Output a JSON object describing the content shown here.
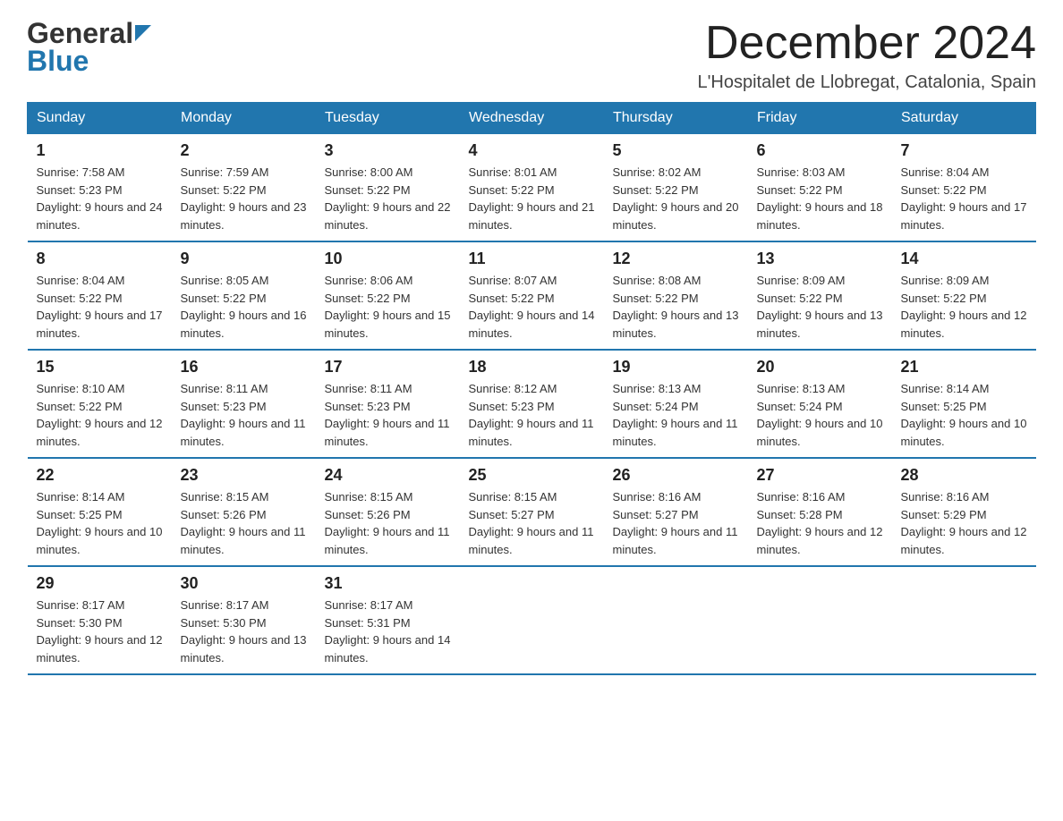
{
  "header": {
    "logo_general": "General",
    "logo_blue": "Blue",
    "month_title": "December 2024",
    "location": "L'Hospitalet de Llobregat, Catalonia, Spain"
  },
  "days_of_week": [
    "Sunday",
    "Monday",
    "Tuesday",
    "Wednesday",
    "Thursday",
    "Friday",
    "Saturday"
  ],
  "weeks": [
    [
      {
        "day": "1",
        "sunrise": "Sunrise: 7:58 AM",
        "sunset": "Sunset: 5:23 PM",
        "daylight": "Daylight: 9 hours and 24 minutes."
      },
      {
        "day": "2",
        "sunrise": "Sunrise: 7:59 AM",
        "sunset": "Sunset: 5:22 PM",
        "daylight": "Daylight: 9 hours and 23 minutes."
      },
      {
        "day": "3",
        "sunrise": "Sunrise: 8:00 AM",
        "sunset": "Sunset: 5:22 PM",
        "daylight": "Daylight: 9 hours and 22 minutes."
      },
      {
        "day": "4",
        "sunrise": "Sunrise: 8:01 AM",
        "sunset": "Sunset: 5:22 PM",
        "daylight": "Daylight: 9 hours and 21 minutes."
      },
      {
        "day": "5",
        "sunrise": "Sunrise: 8:02 AM",
        "sunset": "Sunset: 5:22 PM",
        "daylight": "Daylight: 9 hours and 20 minutes."
      },
      {
        "day": "6",
        "sunrise": "Sunrise: 8:03 AM",
        "sunset": "Sunset: 5:22 PM",
        "daylight": "Daylight: 9 hours and 18 minutes."
      },
      {
        "day": "7",
        "sunrise": "Sunrise: 8:04 AM",
        "sunset": "Sunset: 5:22 PM",
        "daylight": "Daylight: 9 hours and 17 minutes."
      }
    ],
    [
      {
        "day": "8",
        "sunrise": "Sunrise: 8:04 AM",
        "sunset": "Sunset: 5:22 PM",
        "daylight": "Daylight: 9 hours and 17 minutes."
      },
      {
        "day": "9",
        "sunrise": "Sunrise: 8:05 AM",
        "sunset": "Sunset: 5:22 PM",
        "daylight": "Daylight: 9 hours and 16 minutes."
      },
      {
        "day": "10",
        "sunrise": "Sunrise: 8:06 AM",
        "sunset": "Sunset: 5:22 PM",
        "daylight": "Daylight: 9 hours and 15 minutes."
      },
      {
        "day": "11",
        "sunrise": "Sunrise: 8:07 AM",
        "sunset": "Sunset: 5:22 PM",
        "daylight": "Daylight: 9 hours and 14 minutes."
      },
      {
        "day": "12",
        "sunrise": "Sunrise: 8:08 AM",
        "sunset": "Sunset: 5:22 PM",
        "daylight": "Daylight: 9 hours and 13 minutes."
      },
      {
        "day": "13",
        "sunrise": "Sunrise: 8:09 AM",
        "sunset": "Sunset: 5:22 PM",
        "daylight": "Daylight: 9 hours and 13 minutes."
      },
      {
        "day": "14",
        "sunrise": "Sunrise: 8:09 AM",
        "sunset": "Sunset: 5:22 PM",
        "daylight": "Daylight: 9 hours and 12 minutes."
      }
    ],
    [
      {
        "day": "15",
        "sunrise": "Sunrise: 8:10 AM",
        "sunset": "Sunset: 5:22 PM",
        "daylight": "Daylight: 9 hours and 12 minutes."
      },
      {
        "day": "16",
        "sunrise": "Sunrise: 8:11 AM",
        "sunset": "Sunset: 5:23 PM",
        "daylight": "Daylight: 9 hours and 11 minutes."
      },
      {
        "day": "17",
        "sunrise": "Sunrise: 8:11 AM",
        "sunset": "Sunset: 5:23 PM",
        "daylight": "Daylight: 9 hours and 11 minutes."
      },
      {
        "day": "18",
        "sunrise": "Sunrise: 8:12 AM",
        "sunset": "Sunset: 5:23 PM",
        "daylight": "Daylight: 9 hours and 11 minutes."
      },
      {
        "day": "19",
        "sunrise": "Sunrise: 8:13 AM",
        "sunset": "Sunset: 5:24 PM",
        "daylight": "Daylight: 9 hours and 11 minutes."
      },
      {
        "day": "20",
        "sunrise": "Sunrise: 8:13 AM",
        "sunset": "Sunset: 5:24 PM",
        "daylight": "Daylight: 9 hours and 10 minutes."
      },
      {
        "day": "21",
        "sunrise": "Sunrise: 8:14 AM",
        "sunset": "Sunset: 5:25 PM",
        "daylight": "Daylight: 9 hours and 10 minutes."
      }
    ],
    [
      {
        "day": "22",
        "sunrise": "Sunrise: 8:14 AM",
        "sunset": "Sunset: 5:25 PM",
        "daylight": "Daylight: 9 hours and 10 minutes."
      },
      {
        "day": "23",
        "sunrise": "Sunrise: 8:15 AM",
        "sunset": "Sunset: 5:26 PM",
        "daylight": "Daylight: 9 hours and 11 minutes."
      },
      {
        "day": "24",
        "sunrise": "Sunrise: 8:15 AM",
        "sunset": "Sunset: 5:26 PM",
        "daylight": "Daylight: 9 hours and 11 minutes."
      },
      {
        "day": "25",
        "sunrise": "Sunrise: 8:15 AM",
        "sunset": "Sunset: 5:27 PM",
        "daylight": "Daylight: 9 hours and 11 minutes."
      },
      {
        "day": "26",
        "sunrise": "Sunrise: 8:16 AM",
        "sunset": "Sunset: 5:27 PM",
        "daylight": "Daylight: 9 hours and 11 minutes."
      },
      {
        "day": "27",
        "sunrise": "Sunrise: 8:16 AM",
        "sunset": "Sunset: 5:28 PM",
        "daylight": "Daylight: 9 hours and 12 minutes."
      },
      {
        "day": "28",
        "sunrise": "Sunrise: 8:16 AM",
        "sunset": "Sunset: 5:29 PM",
        "daylight": "Daylight: 9 hours and 12 minutes."
      }
    ],
    [
      {
        "day": "29",
        "sunrise": "Sunrise: 8:17 AM",
        "sunset": "Sunset: 5:30 PM",
        "daylight": "Daylight: 9 hours and 12 minutes."
      },
      {
        "day": "30",
        "sunrise": "Sunrise: 8:17 AM",
        "sunset": "Sunset: 5:30 PM",
        "daylight": "Daylight: 9 hours and 13 minutes."
      },
      {
        "day": "31",
        "sunrise": "Sunrise: 8:17 AM",
        "sunset": "Sunset: 5:31 PM",
        "daylight": "Daylight: 9 hours and 14 minutes."
      },
      null,
      null,
      null,
      null
    ]
  ]
}
